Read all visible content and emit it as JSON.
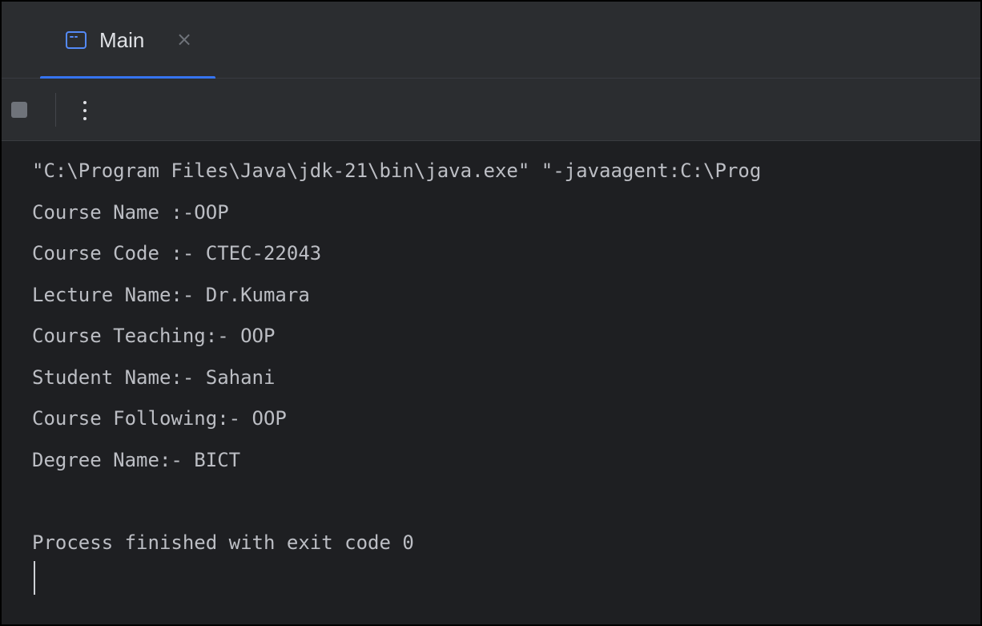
{
  "tab": {
    "label": "Main",
    "close_glyph": "×",
    "icon": "console-window-icon",
    "close_icon": "close-icon"
  },
  "toolbar": {
    "stop_icon": "stop-icon",
    "more_icon": "more-vertical-icon"
  },
  "console": {
    "lines": [
      "\"C:\\Program Files\\Java\\jdk-21\\bin\\java.exe\" \"-javaagent:C:\\Prog",
      "Course Name :-OOP",
      "Course Code :- CTEC-22043",
      "Lecture Name:- Dr.Kumara",
      "Course Teaching:- OOP",
      "Student Name:- Sahani",
      "Course Following:- OOP",
      "Degree Name:- BICT",
      "",
      "Process finished with exit code 0"
    ]
  },
  "colors": {
    "background": "#1e1f22",
    "panel": "#2b2d30",
    "accent": "#3574f0",
    "text": "#bcbec4",
    "tab_text": "#dfe1e5",
    "muted": "#6f737a"
  }
}
